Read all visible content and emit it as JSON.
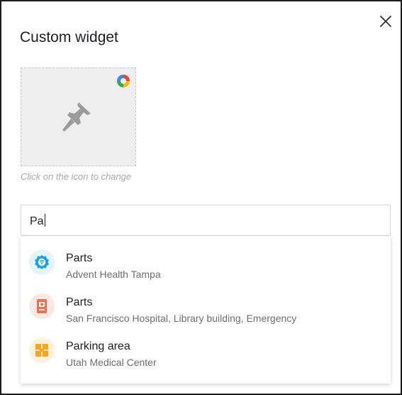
{
  "dialog": {
    "title": "Custom widget",
    "close_icon": "close-icon"
  },
  "icon_picker": {
    "icon": "pushpin-icon",
    "badge_icon": "color-wheel-icon",
    "hint": "Click on the icon to change"
  },
  "search": {
    "value": "Pa"
  },
  "results": [
    {
      "title": "Parts",
      "subtitle": "Advent Health Tampa",
      "icon": "wifi-badge-icon",
      "color": "#1ba3e0",
      "bg": "#e3f4fb"
    },
    {
      "title": "Parts",
      "subtitle": "San Francisco Hospital, Library building, Emergency",
      "icon": "device-icon",
      "color": "#ef6f4f",
      "bg": "#fde9e3"
    },
    {
      "title": "Parking area",
      "subtitle": "Utah Medical Center",
      "icon": "floor-plan-icon",
      "color": "#f5a623",
      "bg": "#fff1dc"
    }
  ]
}
